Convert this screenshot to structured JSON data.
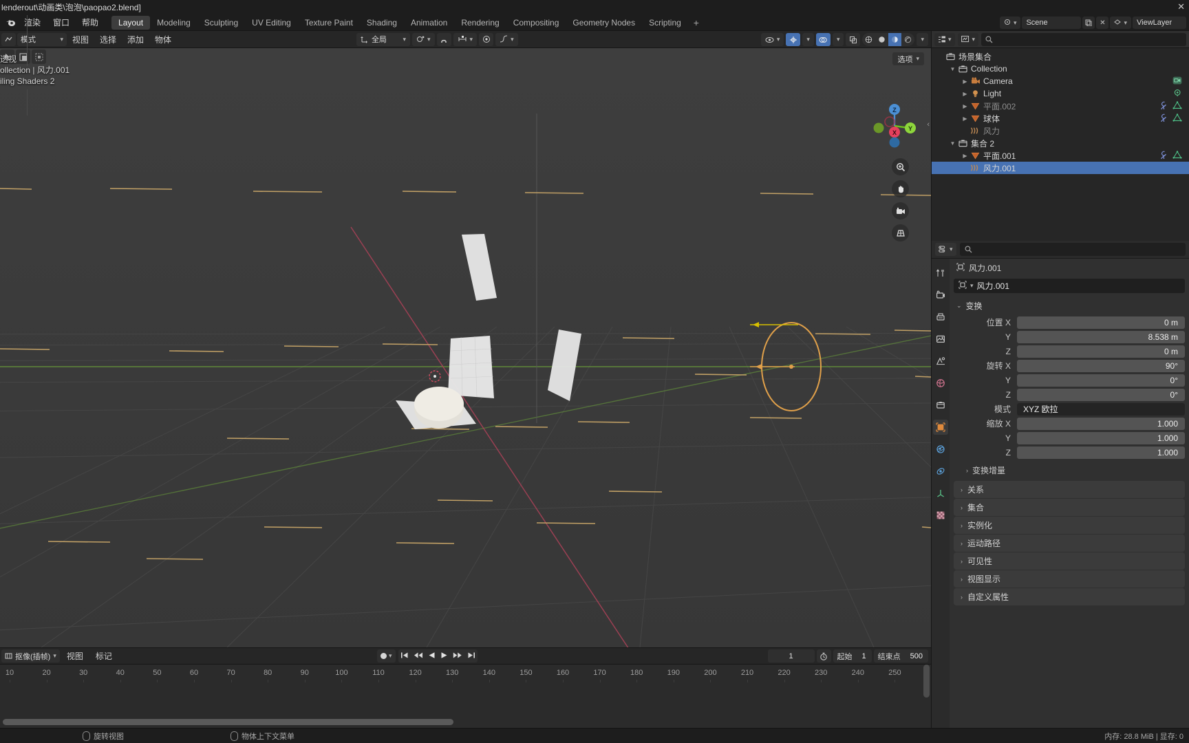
{
  "titlebar": {
    "path": "lenderout\\动画类\\泡泡\\paopao2.blend]",
    "close": "✕"
  },
  "topbar": {
    "menus": [
      "渲染",
      "窗口",
      "帮助"
    ],
    "workspaces": [
      "Layout",
      "Modeling",
      "Sculpting",
      "UV Editing",
      "Texture Paint",
      "Shading",
      "Animation",
      "Rendering",
      "Compositing",
      "Geometry Nodes",
      "Scripting"
    ],
    "active_workspace": "Layout",
    "add_workspace": "+",
    "scene": "Scene",
    "viewlayer": "ViewLayer",
    "scene_icon": "scene-icon",
    "viewlayer_icon": "viewlayer-icon"
  },
  "viewport_header": {
    "mode": "模式",
    "menus": [
      "视图",
      "选择",
      "添加",
      "物体"
    ],
    "transform_orientation": "全局",
    "snap_icon": "magnet-icon",
    "proportional_icon": "proportional-edit-icon",
    "options": "选项"
  },
  "viewport": {
    "overlay_lines": [
      "透视",
      "ollection | 风力.001",
      "iling Shaders 2"
    ],
    "gizmo_axes": [
      "X",
      "Y",
      "Z"
    ]
  },
  "outliner": {
    "filter_icon": "filter-icon",
    "display_mode_icon": "display-mode-icon",
    "search_placeholder": "",
    "rows": [
      {
        "name": "场景集合",
        "icon": "collection-icon",
        "indent": 0,
        "disclosure": "",
        "dim": false,
        "selected": false
      },
      {
        "name": "Collection",
        "icon": "collection-icon",
        "indent": 1,
        "disclosure": "▼",
        "dim": false,
        "selected": false
      },
      {
        "name": "Camera",
        "icon": "camera-icon",
        "indent": 2,
        "disclosure": "▶",
        "dim": false,
        "selected": false,
        "data_icons": [
          "camera-data-icon"
        ]
      },
      {
        "name": "Light",
        "icon": "light-icon",
        "indent": 2,
        "disclosure": "▶",
        "dim": false,
        "selected": false,
        "data_icons": [
          "light-data-icon"
        ]
      },
      {
        "name": "平面.002",
        "icon": "mesh-icon",
        "indent": 2,
        "disclosure": "▶",
        "dim": true,
        "selected": false,
        "data_icons": [
          "modifier-icon",
          "mesh-data-icon"
        ]
      },
      {
        "name": "球体",
        "icon": "mesh-icon",
        "indent": 2,
        "disclosure": "▶",
        "dim": false,
        "selected": false,
        "data_icons": [
          "modifier-icon",
          "mesh-data-icon"
        ]
      },
      {
        "name": "风力",
        "icon": "force-field-icon",
        "indent": 2,
        "disclosure": "",
        "dim": true,
        "selected": false
      },
      {
        "name": "集合 2",
        "icon": "collection-icon",
        "indent": 1,
        "disclosure": "▼",
        "dim": false,
        "selected": false
      },
      {
        "name": "平面.001",
        "icon": "mesh-icon",
        "indent": 2,
        "disclosure": "▶",
        "dim": false,
        "selected": false,
        "data_icons": [
          "modifier-icon",
          "mesh-data-icon"
        ]
      },
      {
        "name": "风力.001",
        "icon": "force-field-icon",
        "indent": 2,
        "disclosure": "",
        "dim": false,
        "selected": true
      }
    ]
  },
  "properties": {
    "editor_icon": "properties-editor-icon",
    "search_placeholder": "",
    "breadcrumb": "风力.001",
    "breadcrumb_icon": "object-icon",
    "object_name": "风力.001",
    "tabs": [
      "tool-icon",
      "render-icon",
      "output-icon",
      "viewlayer-icon",
      "scene-icon",
      "world-icon",
      "collection-icon",
      "object-icon",
      "physics-icon",
      "constraint-icon",
      "object-data-icon",
      "texture-icon"
    ],
    "active_tab_index": 7,
    "transform_title": "变换",
    "fields": [
      {
        "label": "位置 X",
        "value": "0 m"
      },
      {
        "label": "Y",
        "value": "8.538 m"
      },
      {
        "label": "Z",
        "value": "0 m"
      },
      {
        "label": "旋转 X",
        "value": "90°"
      },
      {
        "label": "Y",
        "value": "0°"
      },
      {
        "label": "Z",
        "value": "0°"
      },
      {
        "label": "模式",
        "value": "XYZ 欧拉",
        "enum": true
      },
      {
        "label": "缩放 X",
        "value": "1.000"
      },
      {
        "label": "Y",
        "value": "1.000"
      },
      {
        "label": "Z",
        "value": "1.000"
      }
    ],
    "delta_transform": "变换增量",
    "closed_panels": [
      "关系",
      "集合",
      "实例化",
      "运动路径",
      "可见性",
      "视图显示",
      "自定义属性"
    ]
  },
  "timeline": {
    "editor_label": "抠像(插帧)",
    "menus": [
      "视图",
      "标记"
    ],
    "playback_icons": [
      "jump-start-icon",
      "prev-keyframe-icon",
      "play-reverse-icon",
      "play-icon",
      "next-keyframe-icon",
      "jump-end-icon"
    ],
    "current_frame": "1",
    "start_label": "起始",
    "start_value": "1",
    "end_label": "结束点",
    "end_value": "500",
    "ticks": [
      10,
      20,
      30,
      40,
      50,
      60,
      70,
      80,
      90,
      100,
      110,
      120,
      130,
      140,
      150,
      160,
      170,
      180,
      190,
      200,
      210,
      220,
      230,
      240,
      250
    ]
  },
  "statusbar": {
    "items": [
      {
        "icon": "mouse-icon",
        "label": "旋转视图"
      },
      {
        "icon": "mouse-icon",
        "label": "物体上下文菜单"
      }
    ],
    "memory": "内存: 28.8 MiB | 显存: 0"
  },
  "colors": {
    "accent_blue": "#4772b3",
    "select_orange": "#e0a04a",
    "axis_x": "#b4425a",
    "axis_y": "#6a9e3a",
    "viewport_bg": "#3b3b3b"
  }
}
